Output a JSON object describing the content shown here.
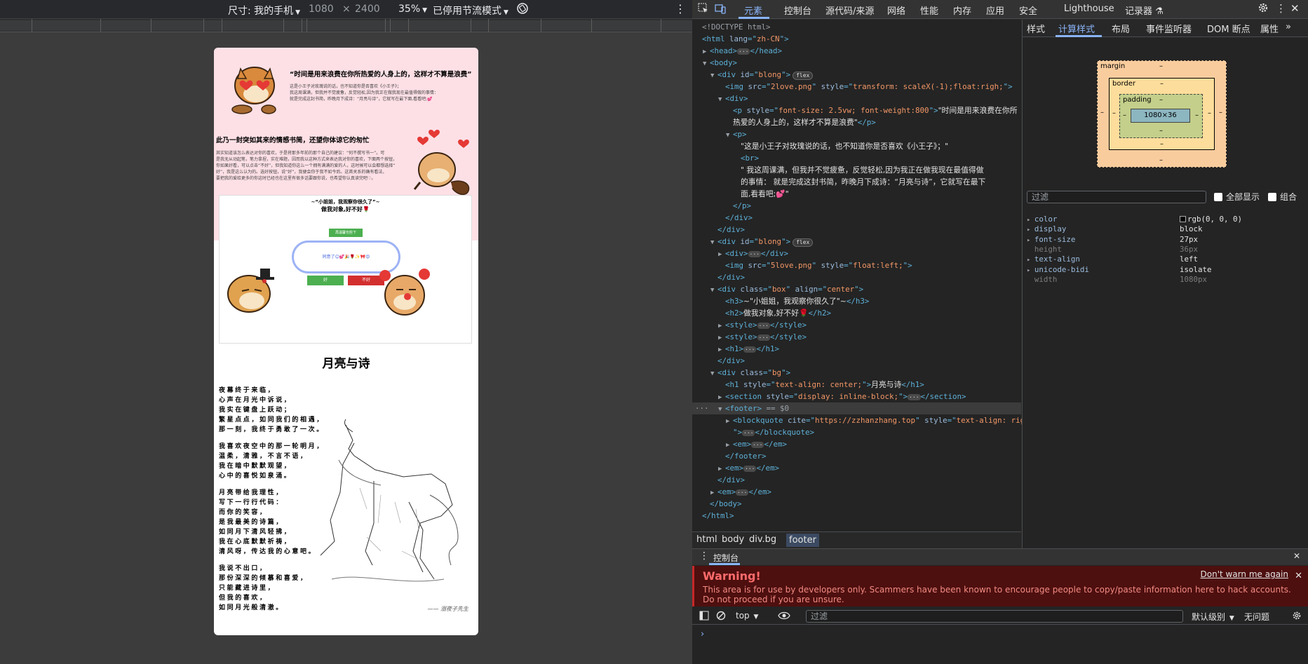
{
  "device_toolbar": {
    "dimensions_label": "尺寸: 我的手机",
    "width": "1080",
    "times": "×",
    "height": "2400",
    "zoom": "35%",
    "throttle": "已停用节流模式"
  },
  "page": {
    "quote_title": "“时间是用来浪费在你所热爱的人身上的，这样才不算是浪费”",
    "intro_1": "这是小王子对玫瑰说的话，也不知道你是否喜欢《小王子》；",
    "intro_2": "我这周课满，但我并不觉疲惫，反觉轻松,因为我正在做我现在最值得做的事情：",
    "intro_3": "就是完成这封书简，昨晚月下成诗：“月亮与诗”，它就写在最下面,看看吧;💕",
    "heading": "此乃一封突如其来的情感书简，还望你体谅它的匆忙",
    "para_1": "其实知道该怎么表达对你的喜欢，于是将那多年前的那个自己的建议：“何不撰写书一”。可",
    "para_2": "是我无从动起笔，笔力拿捏，实在难题，因而我以这种方式来表达我对你的喜欢，下面两个按钮，",
    "para_3": "你如果好看，可以点击“不好”，但我知道你这么一个拥有满满的爱的人，这时候可以会都想选择“",
    "para_4": "好”，我是这么认为的。选好按钮，说“好”，我便会你于我不如今后。这首关系的确有看法，",
    "para_5": "要把我的爱给更多的你这时已经也在这里有很多话要跟你说，也希望你认真读完吧♡。",
    "box_h3": "~“小姐姐，我观察你很久了”~",
    "box_h2": "做我对象,好不好🌹",
    "btn_accept": "再温馨也些下",
    "oval_text": "同意了😊💕🎉🌹✨🎀😍",
    "btn_ok": "好",
    "btn_no": "不好",
    "poem_title": "月亮与诗",
    "poem": [
      [
        "夜幕终于来临，",
        "心声在月光中诉说，",
        "我实在键盘上跃动；",
        "繁星点点，如同我们的相遇，",
        "那一刻，我终于勇敢了一次。"
      ],
      [
        "我喜欢夜空中的那一轮明月，",
        "温柔，清雅，不言不语，",
        "我在暗中默默观望，",
        "心中的喜悦如泉涌。"
      ],
      [
        "月亮带给我理性，",
        "写下一行行代码：",
        "而你的笑容，",
        "是我最美的诗篇，",
        "如同月下清风轻拂，",
        "我在心底默默祈祷，",
        "清风呀，传达我的心意吧。"
      ],
      [
        "我说不出口，",
        "那份深深的倾慕和喜爱，",
        "只能藏进诗里，",
        "但我的喜欢，",
        "如同月光般清澈。"
      ]
    ],
    "signature": "—— 溺夜子先生"
  },
  "devtools": {
    "tabs": [
      "元素",
      "控制台",
      "源代码/来源",
      "网络",
      "性能",
      "内存",
      "应用",
      "安全",
      "Lighthouse",
      "记录器 ⚗"
    ],
    "active_tab": "元素",
    "dom_lines": [
      {
        "indent": 0,
        "tw": "",
        "html": [
          [
            "cmt",
            "<!DOCTYPE html>"
          ]
        ]
      },
      {
        "indent": 0,
        "tw": "",
        "html": [
          [
            "tag",
            "<html "
          ],
          [
            "an",
            "lang"
          ],
          [
            "tag",
            "=\""
          ],
          [
            "av",
            "zh-CN"
          ],
          [
            "tag",
            "\">"
          ]
        ]
      },
      {
        "indent": 1,
        "tw": "▶",
        "html": [
          [
            "tag",
            "<head>"
          ],
          [
            "ell",
            "···"
          ],
          [
            "tag",
            "</head>"
          ]
        ]
      },
      {
        "indent": 1,
        "tw": "▼",
        "html": [
          [
            "tag",
            "<body>"
          ]
        ]
      },
      {
        "indent": 2,
        "tw": "▼",
        "html": [
          [
            "tag",
            "<div "
          ],
          [
            "an",
            "id"
          ],
          [
            "tag",
            "=\""
          ],
          [
            "av",
            "blong"
          ],
          [
            "tag",
            "\">"
          ],
          [
            "pill",
            "flex"
          ]
        ]
      },
      {
        "indent": 3,
        "tw": "",
        "html": [
          [
            "tag",
            "<img "
          ],
          [
            "an",
            "src"
          ],
          [
            "tag",
            "=\""
          ],
          [
            "av",
            "2love.png"
          ],
          [
            "tag",
            "\" "
          ],
          [
            "an",
            "style"
          ],
          [
            "tag",
            "=\""
          ],
          [
            "av",
            "transform: scaleX(-1);float:righ;"
          ],
          [
            "tag",
            "\">"
          ]
        ]
      },
      {
        "indent": 3,
        "tw": "▼",
        "html": [
          [
            "tag",
            "<div>"
          ]
        ]
      },
      {
        "indent": 4,
        "tw": "",
        "html": [
          [
            "tag",
            "<p "
          ],
          [
            "an",
            "style"
          ],
          [
            "tag",
            "=\""
          ],
          [
            "av",
            "font-size: 2.5vw; font-weight:800"
          ],
          [
            "tag",
            "\">"
          ],
          [
            "txt",
            "\"时间是用来浪费在你所"
          ]
        ]
      },
      {
        "indent": 4,
        "tw": "",
        "html": [
          [
            "txt",
            "热爱的人身上的，这样才不算是浪费\""
          ],
          [
            "tag",
            "</p>"
          ]
        ]
      },
      {
        "indent": 4,
        "tw": "▼",
        "html": [
          [
            "tag",
            "<p>"
          ]
        ]
      },
      {
        "indent": 5,
        "tw": "",
        "html": [
          [
            "txt",
            "\"这是小王子对玫瑰说的话，也不知道你是否喜欢《小王子》；\""
          ]
        ]
      },
      {
        "indent": 5,
        "tw": "",
        "html": [
          [
            "tag",
            "<br>"
          ]
        ]
      },
      {
        "indent": 5,
        "tw": "",
        "html": [
          [
            "txt",
            "\" 我这周课满，但我并不觉疲惫，反觉轻松,因为我正在做我现在最值得做"
          ]
        ]
      },
      {
        "indent": 5,
        "tw": "",
        "html": [
          [
            "txt",
            "的事情： 就是完成这封书简，昨晚月下成诗：“月亮与诗”，它就写在最下"
          ]
        ]
      },
      {
        "indent": 5,
        "tw": "",
        "html": [
          [
            "txt",
            "面,看看吧;💕\""
          ]
        ]
      },
      {
        "indent": 4,
        "tw": "",
        "html": [
          [
            "tag",
            "</p>"
          ]
        ]
      },
      {
        "indent": 3,
        "tw": "",
        "html": [
          [
            "tag",
            "</div>"
          ]
        ]
      },
      {
        "indent": 2,
        "tw": "",
        "html": [
          [
            "tag",
            "</div>"
          ]
        ]
      },
      {
        "indent": 2,
        "tw": "▼",
        "html": [
          [
            "tag",
            "<div "
          ],
          [
            "an",
            "id"
          ],
          [
            "tag",
            "=\""
          ],
          [
            "av",
            "blong"
          ],
          [
            "tag",
            "\">"
          ],
          [
            "pill",
            "flex"
          ]
        ]
      },
      {
        "indent": 3,
        "tw": "▶",
        "html": [
          [
            "tag",
            "<div>"
          ],
          [
            "ell",
            "···"
          ],
          [
            "tag",
            "</div>"
          ]
        ]
      },
      {
        "indent": 3,
        "tw": "",
        "html": [
          [
            "tag",
            "<img "
          ],
          [
            "an",
            "src"
          ],
          [
            "tag",
            "=\""
          ],
          [
            "av",
            "5love.png"
          ],
          [
            "tag",
            "\" "
          ],
          [
            "an",
            "style"
          ],
          [
            "tag",
            "=\""
          ],
          [
            "av",
            "float:left;"
          ],
          [
            "tag",
            "\">"
          ]
        ]
      },
      {
        "indent": 2,
        "tw": "",
        "html": [
          [
            "tag",
            "</div>"
          ]
        ]
      },
      {
        "indent": 2,
        "tw": "▼",
        "html": [
          [
            "tag",
            "<div "
          ],
          [
            "an",
            "class"
          ],
          [
            "tag",
            "=\""
          ],
          [
            "av",
            "box"
          ],
          [
            "tag",
            "\" "
          ],
          [
            "an",
            "align"
          ],
          [
            "tag",
            "=\""
          ],
          [
            "av",
            "center"
          ],
          [
            "tag",
            "\">"
          ]
        ]
      },
      {
        "indent": 3,
        "tw": "",
        "html": [
          [
            "tag",
            "<h3>"
          ],
          [
            "txt",
            "~\"小姐姐，我观察你很久了\"~"
          ],
          [
            "tag",
            "</h3>"
          ]
        ]
      },
      {
        "indent": 3,
        "tw": "",
        "html": [
          [
            "tag",
            "<h2>"
          ],
          [
            "txt",
            "做我对象,好不好🌹"
          ],
          [
            "tag",
            "</h2>"
          ]
        ]
      },
      {
        "indent": 3,
        "tw": "▶",
        "html": [
          [
            "tag",
            "<style>"
          ],
          [
            "ell",
            "···"
          ],
          [
            "tag",
            "</style>"
          ]
        ]
      },
      {
        "indent": 3,
        "tw": "▶",
        "html": [
          [
            "tag",
            "<style>"
          ],
          [
            "ell",
            "···"
          ],
          [
            "tag",
            "</style>"
          ]
        ]
      },
      {
        "indent": 3,
        "tw": "▶",
        "html": [
          [
            "tag",
            "<h1>"
          ],
          [
            "ell",
            "···"
          ],
          [
            "tag",
            "</h1>"
          ]
        ]
      },
      {
        "indent": 2,
        "tw": "",
        "html": [
          [
            "tag",
            "</div>"
          ]
        ]
      },
      {
        "indent": 2,
        "tw": "▼",
        "html": [
          [
            "tag",
            "<div "
          ],
          [
            "an",
            "class"
          ],
          [
            "tag",
            "=\""
          ],
          [
            "av",
            "bg"
          ],
          [
            "tag",
            "\">"
          ]
        ]
      },
      {
        "indent": 3,
        "tw": "",
        "html": [
          [
            "tag",
            "<h1 "
          ],
          [
            "an",
            "style"
          ],
          [
            "tag",
            "=\""
          ],
          [
            "av",
            "text-align: center;"
          ],
          [
            "tag",
            "\">"
          ],
          [
            "txt",
            "月亮与诗"
          ],
          [
            "tag",
            "</h1>"
          ]
        ]
      },
      {
        "indent": 3,
        "tw": "▶",
        "html": [
          [
            "tag",
            "<section "
          ],
          [
            "an",
            "style"
          ],
          [
            "tag",
            "=\""
          ],
          [
            "av",
            "display: inline-block;"
          ],
          [
            "tag",
            "\">"
          ],
          [
            "ell",
            "···"
          ],
          [
            "tag",
            "</section>"
          ]
        ]
      },
      {
        "indent": 3,
        "tw": "▼",
        "sel": true,
        "html": [
          [
            "tag",
            "<footer>"
          ],
          [
            "cmt",
            " == $0"
          ]
        ]
      },
      {
        "indent": 4,
        "tw": "▶",
        "html": [
          [
            "tag",
            "<blockquote "
          ],
          [
            "an",
            "cite"
          ],
          [
            "tag",
            "=\""
          ],
          [
            "av",
            "https://zzhanzhang.top"
          ],
          [
            "tag",
            "\" "
          ],
          [
            "an",
            "style"
          ],
          [
            "tag",
            "=\""
          ],
          [
            "av",
            "text-align: right;"
          ]
        ]
      },
      {
        "indent": 4,
        "tw": "",
        "html": [
          [
            "tag",
            "\">"
          ],
          [
            "ell",
            "···"
          ],
          [
            "tag",
            "</blockquote>"
          ]
        ]
      },
      {
        "indent": 4,
        "tw": "▶",
        "html": [
          [
            "tag",
            "<em>"
          ],
          [
            "ell",
            "···"
          ],
          [
            "tag",
            "</em>"
          ]
        ]
      },
      {
        "indent": 3,
        "tw": "",
        "html": [
          [
            "tag",
            "</footer>"
          ]
        ]
      },
      {
        "indent": 3,
        "tw": "▶",
        "html": [
          [
            "tag",
            "<em>"
          ],
          [
            "ell",
            "···"
          ],
          [
            "tag",
            "</em>"
          ]
        ]
      },
      {
        "indent": 2,
        "tw": "",
        "html": [
          [
            "tag",
            "</div>"
          ]
        ]
      },
      {
        "indent": 2,
        "tw": "▶",
        "html": [
          [
            "tag",
            "<em>"
          ],
          [
            "ell",
            "···"
          ],
          [
            "tag",
            "</em>"
          ]
        ]
      },
      {
        "indent": 1,
        "tw": "",
        "html": [
          [
            "tag",
            "</body>"
          ]
        ]
      },
      {
        "indent": 0,
        "tw": "",
        "html": [
          [
            "tag",
            "</html>"
          ]
        ]
      }
    ],
    "breadcrumbs": [
      "html",
      "body",
      "div.bg",
      "footer"
    ],
    "styles_tabs": [
      "样式",
      "计算样式",
      "布局",
      "事件监听器",
      "DOM 断点",
      "属性"
    ],
    "styles_active": "计算样式",
    "box_model": {
      "margin": "margin",
      "border": "border",
      "padding": "padding",
      "content": "1080×36",
      "dash": "–"
    },
    "filter_placeholder": "过滤",
    "show_all": "全部显示",
    "group": "组合",
    "computed": [
      {
        "name": "color",
        "value": "rgb(0, 0, 0)",
        "swatch": true
      },
      {
        "name": "display",
        "value": "block"
      },
      {
        "name": "font-size",
        "value": "27px"
      },
      {
        "name": "height",
        "value": "36px",
        "dim": true
      },
      {
        "name": "text-align",
        "value": "left"
      },
      {
        "name": "unicode-bidi",
        "value": "isolate"
      },
      {
        "name": "width",
        "value": "1080px",
        "dim": true
      }
    ],
    "drawer": {
      "tab": "控制台",
      "warning_title": "Warning!",
      "warning_body": "This area is for use by developers only. Scammers have been known to encourage people to copy/paste information here to hack accounts. Do not proceed if you are unsure.",
      "dont_warn": "Don't warn me again",
      "context": "top",
      "filter_placeholder": "过滤",
      "level": "默认级别",
      "issues": "无问题"
    }
  }
}
